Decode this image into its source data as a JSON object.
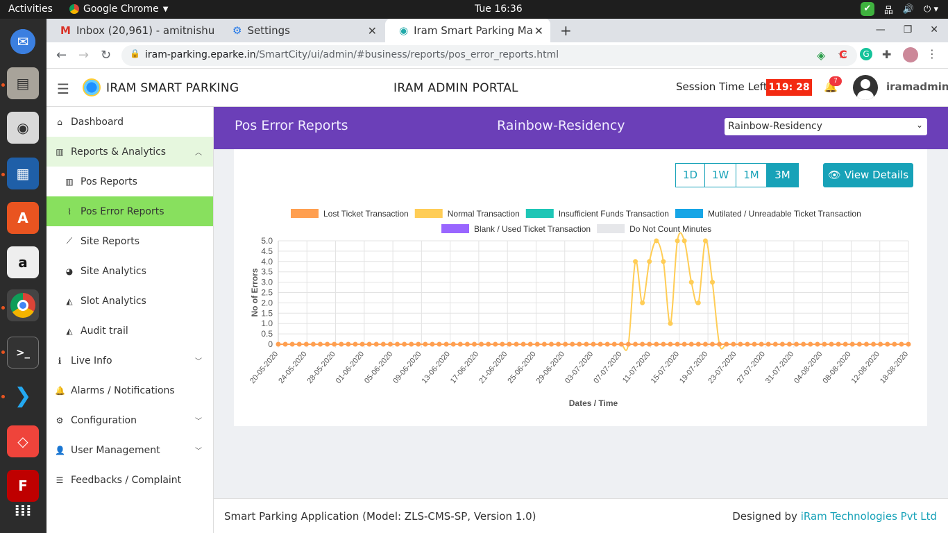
{
  "os": {
    "activities": "Activities",
    "app_menu": "Google Chrome",
    "clock": "Tue 16:36"
  },
  "browser": {
    "tabs": [
      {
        "label": "Inbox (20,961) - amitnishu"
      },
      {
        "label": "Settings"
      },
      {
        "label": "Iram Smart Parking Manage"
      }
    ],
    "url_host": "iram-parking.eparke.in",
    "url_path": "/SmartCity/ui/admin/#business/reports/pos_error_reports.html"
  },
  "header": {
    "brand": "IRAM SMART PARKING",
    "portal": "IRAM ADMIN PORTAL",
    "session_label": "Session Time Left:",
    "session_time": "119: 28",
    "notif_count": "7",
    "username": "iramadmin"
  },
  "sidebar": {
    "items": [
      {
        "label": "Dashboard",
        "icon": "home-icon"
      },
      {
        "label": "Reports & Analytics",
        "icon": "bar-chart-icon"
      },
      {
        "label": "Pos Reports",
        "icon": "bar-chart-icon"
      },
      {
        "label": "Pos Error Reports",
        "icon": "line-chart-icon"
      },
      {
        "label": "Site Reports",
        "icon": "line-chart-icon"
      },
      {
        "label": "Site Analytics",
        "icon": "pie-chart-icon"
      },
      {
        "label": "Slot Analytics",
        "icon": "area-chart-icon"
      },
      {
        "label": "Audit trail",
        "icon": "area-chart-icon"
      },
      {
        "label": "Live Info",
        "icon": "info-icon"
      },
      {
        "label": "Alarms / Notifications",
        "icon": "bell-icon"
      },
      {
        "label": "Configuration",
        "icon": "gears-icon"
      },
      {
        "label": "User Management",
        "icon": "user-icon"
      },
      {
        "label": "Feedbacks / Complaint",
        "icon": "list-icon"
      }
    ]
  },
  "page": {
    "title": "Pos Error Reports",
    "site_name": "Rainbow-Residency",
    "site_select": "Rainbow-Residency",
    "ranges": [
      "1D",
      "1W",
      "1M",
      "3M"
    ],
    "selected_range": "3M",
    "view_details": "View Details"
  },
  "footer": {
    "left": "Smart Parking Application (Model: ZLS-CMS-SP, Version 1.0)",
    "right_prefix": "Designed by ",
    "right_link": "iRam Technologies Pvt Ltd"
  },
  "colors": {
    "banner": "#6b3fb8",
    "accent": "#17a2b8",
    "active_menu": "#88e05e",
    "timer": "#f32a12"
  },
  "chart_data": {
    "type": "line",
    "xlabel": "Dates / Time",
    "ylabel": "No of Errors",
    "ylim": [
      0,
      5
    ],
    "yticks": [
      "5.0",
      "4.5",
      "4.0",
      "3.5",
      "3.0",
      "2.5",
      "2.0",
      "1.5",
      "1.0",
      "0.5",
      "0"
    ],
    "x_ticks": [
      "20-05-2020",
      "24-05-2020",
      "28-05-2020",
      "01-06-2020",
      "05-06-2020",
      "09-06-2020",
      "13-06-2020",
      "17-06-2020",
      "21-06-2020",
      "25-06-2020",
      "29-06-2020",
      "03-07-2020",
      "07-07-2020",
      "11-07-2020",
      "15-07-2020",
      "19-07-2020",
      "23-07-2020",
      "27-07-2020",
      "31-07-2020",
      "04-08-2020",
      "08-08-2020",
      "12-08-2020",
      "18-08-2020"
    ],
    "legend": [
      {
        "name": "Lost Ticket Transaction",
        "color": "#ff9f50"
      },
      {
        "name": "Normal Transaction",
        "color": "#ffcd56"
      },
      {
        "name": "Insufficient Funds Transaction",
        "color": "#1ec6b6"
      },
      {
        "name": "Mutilated / Unreadable Ticket Transaction",
        "color": "#16a5e6"
      },
      {
        "name": "Blank / Used Ticket Transaction",
        "color": "#9966ff"
      },
      {
        "name": "Do Not Count Minutes",
        "color": "#e6e7ea"
      }
    ],
    "num_points": 91,
    "series": [
      {
        "name": "Normal Transaction",
        "nonzero": {
          "51": 4,
          "52": 2,
          "53": 4,
          "54": 5,
          "55": 4,
          "56": 1,
          "57": 5,
          "58": 5,
          "59": 3,
          "60": 2,
          "61": 5,
          "62": 3
        }
      },
      {
        "name": "Lost Ticket Transaction",
        "nonzero": {}
      }
    ]
  }
}
